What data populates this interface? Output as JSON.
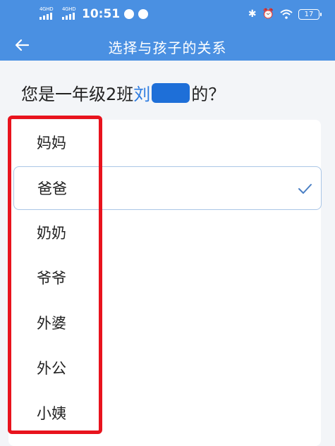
{
  "status_bar": {
    "sim1_label": "4GHD",
    "sim2_label": "4GHD",
    "time": "10:51",
    "battery": "17"
  },
  "nav": {
    "title": "选择与孩子的关系"
  },
  "question": {
    "prefix": "您是一年级2班",
    "name_visible": "刘",
    "suffix": "的？"
  },
  "options": [
    {
      "label": "妈妈",
      "selected": false
    },
    {
      "label": "爸爸",
      "selected": true
    },
    {
      "label": "奶奶",
      "selected": false
    },
    {
      "label": "爷爷",
      "selected": false
    },
    {
      "label": "外婆",
      "selected": false
    },
    {
      "label": "外公",
      "selected": false
    },
    {
      "label": "小姨",
      "selected": false
    }
  ],
  "colors": {
    "header": "#4a90e2",
    "accent": "#2f7de1",
    "annotation": "#e8131d"
  }
}
